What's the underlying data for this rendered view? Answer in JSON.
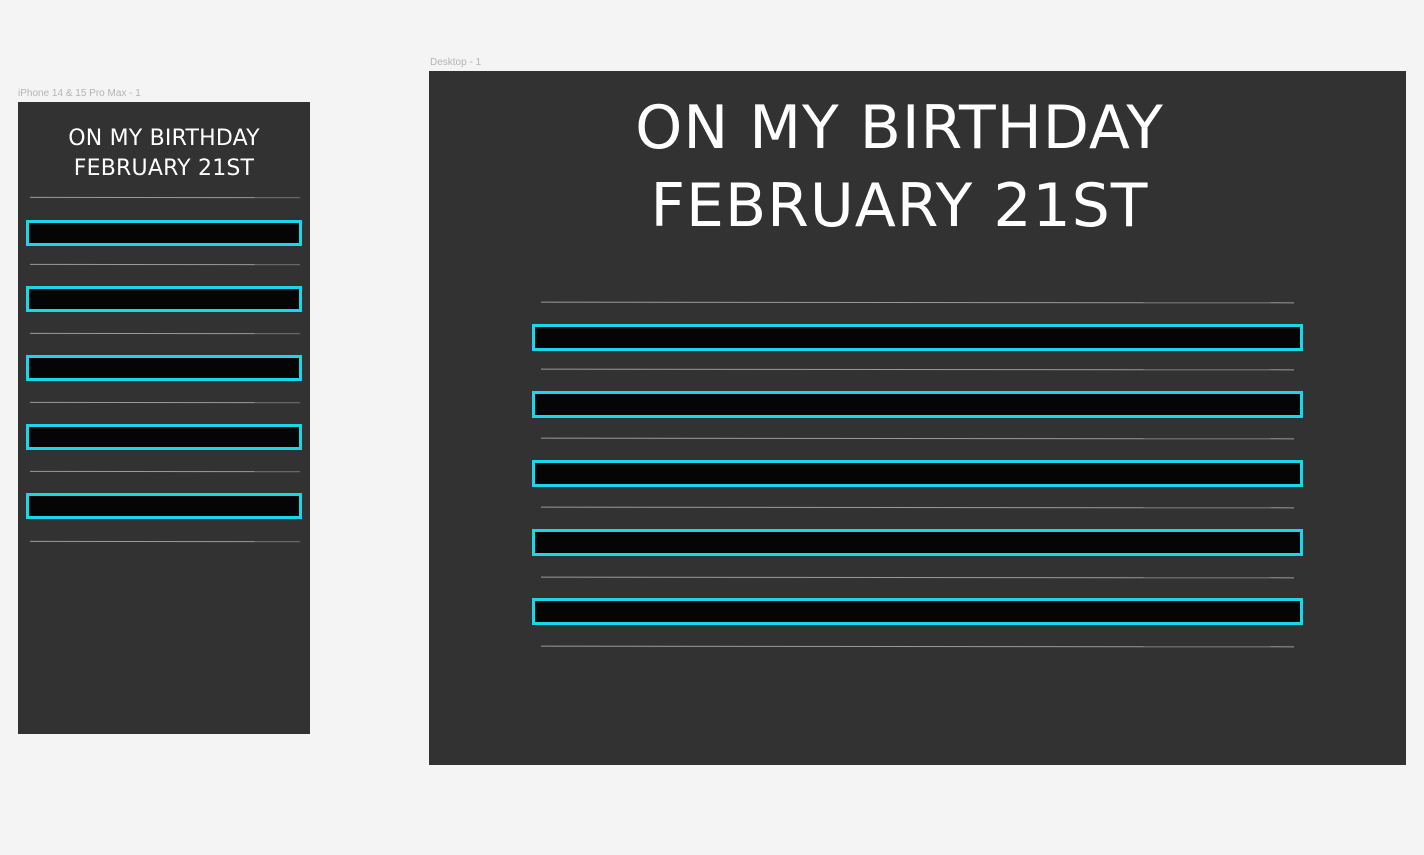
{
  "mobile": {
    "frame_label": "iPhone 14 & 15 Pro Max - 1",
    "title_line1": "ON MY BIRTHDAY",
    "title_line2": "FEBRUARY 21ST",
    "items": 5
  },
  "desktop": {
    "frame_label": "Desktop - 1",
    "title_line1": "ON MY BIRTHDAY",
    "title_line2": "FEBRUARY 21ST",
    "items": 5
  },
  "colors": {
    "canvas_background": "#f4f4f4",
    "frame_background": "#323232",
    "bar_fill": "#050505",
    "bar_border": "#16d7ec",
    "divider": "#9a9a9a",
    "title_text": "#ffffff"
  }
}
